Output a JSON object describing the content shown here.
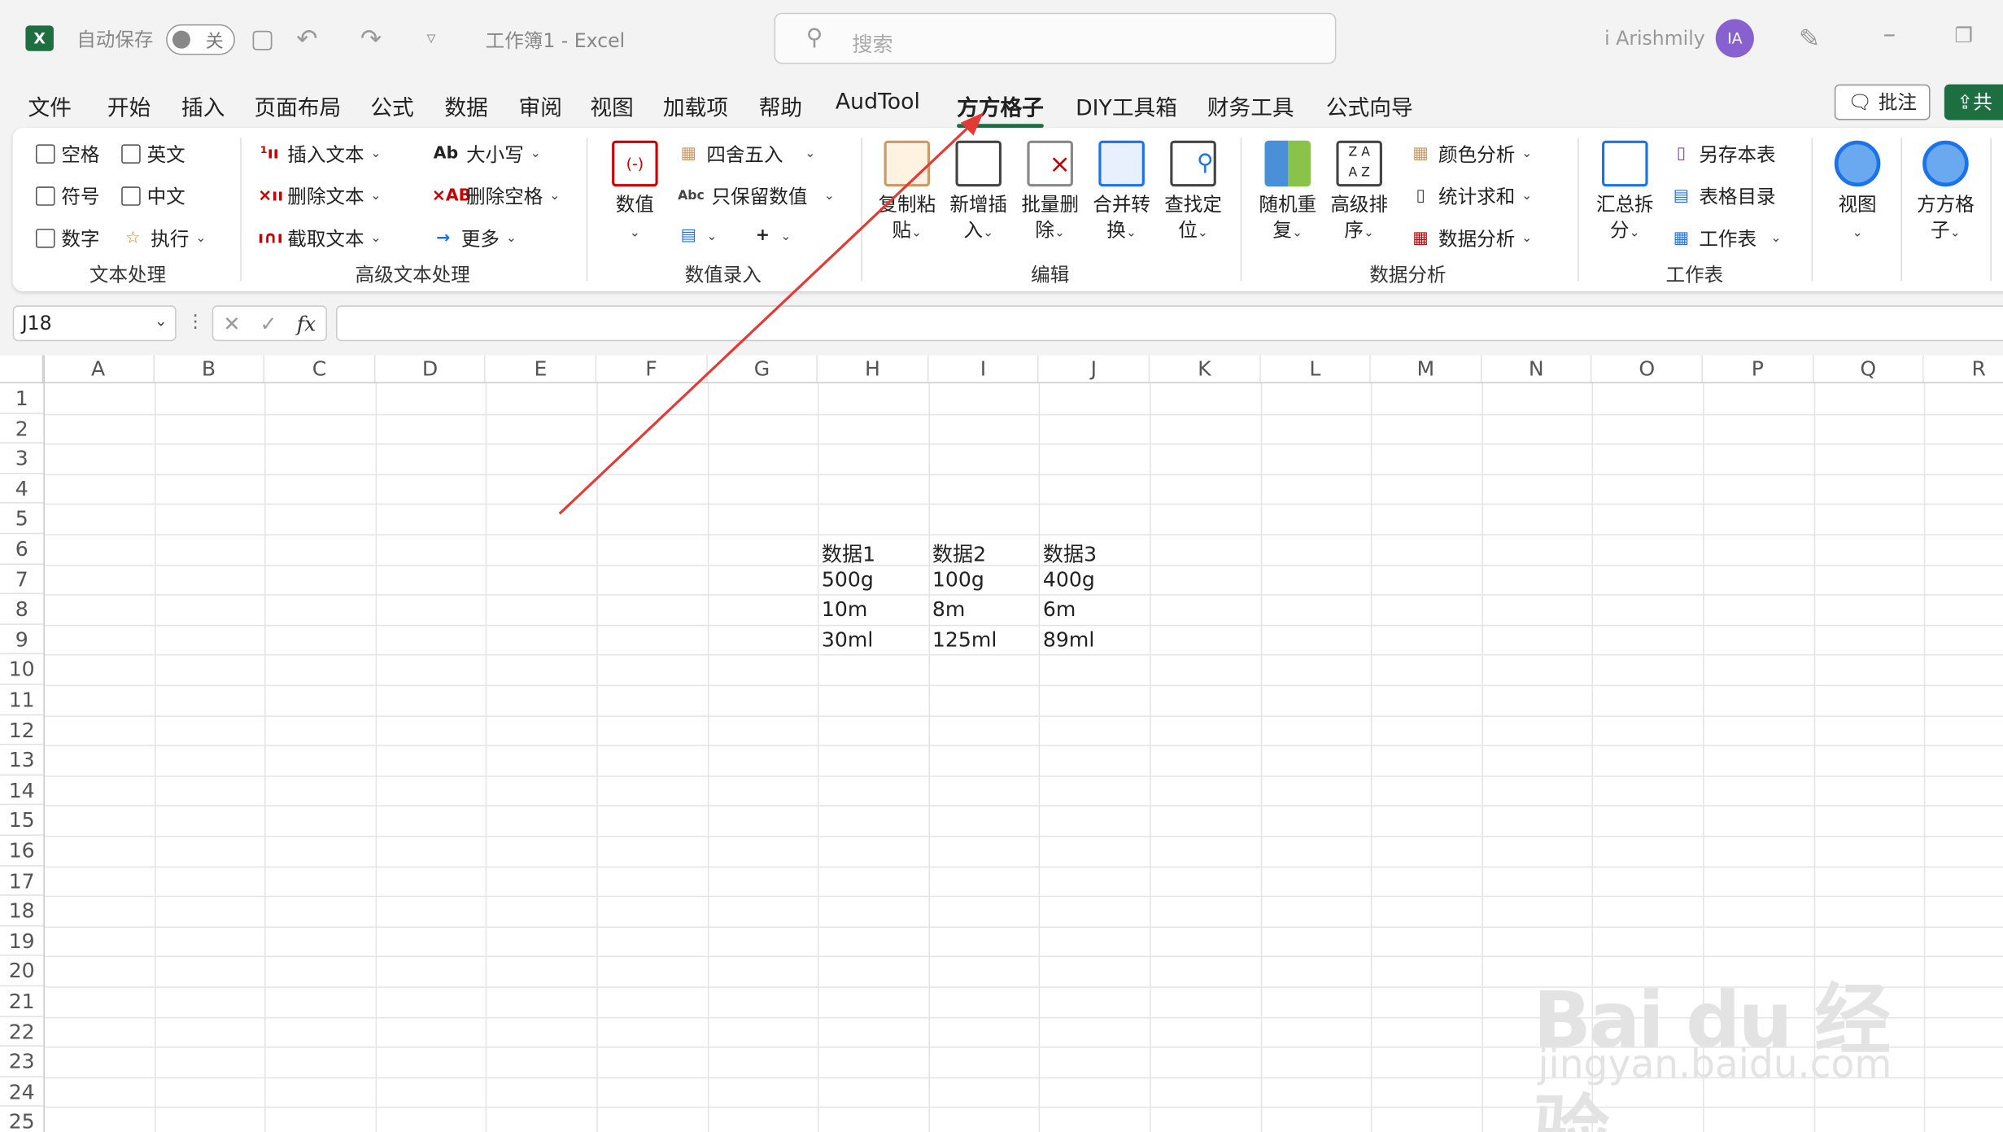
{
  "titlebar": {
    "autosave_label": "自动保存",
    "toggle_label": "关",
    "workbook_title": "工作簿1  -  Excel",
    "search_placeholder": "搜索",
    "user_name": "i Arishmily",
    "avatar_initials": "IA"
  },
  "tabs": [
    "文件",
    "开始",
    "插入",
    "页面布局",
    "公式",
    "数据",
    "审阅",
    "视图",
    "加载项",
    "帮助",
    "AudTool",
    "方方格子",
    "DIY工具箱",
    "财务工具",
    "公式向导"
  ],
  "active_tab": "方方格子",
  "header_buttons": {
    "comment": "批注",
    "share": "共"
  },
  "ribbon": {
    "text_group": {
      "label": "文本处理",
      "items": [
        "空格",
        "英文",
        "符号",
        "中文",
        "数字",
        "执行"
      ]
    },
    "adv_text_group": {
      "label": "高级文本处理",
      "items": [
        "插入文本",
        "删除文本",
        "截取文本",
        "大小写",
        "删除空格",
        "更多"
      ]
    },
    "num_group": {
      "label": "数值录入",
      "big": "数值",
      "items": [
        "四舍五入",
        "只保留数值"
      ]
    },
    "edit_group": {
      "label": "编辑",
      "big": [
        {
          "l1": "复制粘",
          "l2": "贴"
        },
        {
          "l1": "新增插",
          "l2": "入"
        },
        {
          "l1": "批量删",
          "l2": "除"
        },
        {
          "l1": "合并转",
          "l2": "换"
        },
        {
          "l1": "查找定",
          "l2": "位"
        }
      ]
    },
    "analysis_group": {
      "label": "数据分析",
      "big": [
        {
          "l1": "随机重",
          "l2": "复"
        },
        {
          "l1": "高级排",
          "l2": "序"
        }
      ],
      "items": [
        "颜色分析",
        "统计求和",
        "数据分析"
      ]
    },
    "sheet_group": {
      "label": "工作表",
      "big": {
        "l1": "汇总拆",
        "l2": "分"
      },
      "items": [
        "另存本表",
        "表格目录",
        "工作表"
      ]
    },
    "view": {
      "label": "视图"
    },
    "ffgz": {
      "l1": "方方格",
      "l2": "子"
    }
  },
  "formula_bar": {
    "namebox": "J18",
    "fx": "fx"
  },
  "columns": [
    "A",
    "B",
    "C",
    "D",
    "E",
    "F",
    "G",
    "H",
    "I",
    "J",
    "K",
    "L",
    "M",
    "N",
    "O",
    "P",
    "Q",
    "R"
  ],
  "rows": [
    "1",
    "2",
    "3",
    "4",
    "5",
    "6",
    "7",
    "8",
    "9",
    "10",
    "11",
    "12",
    "13",
    "14",
    "15",
    "16",
    "17",
    "18",
    "19",
    "20",
    "21",
    "22",
    "23",
    "24",
    "25"
  ],
  "cells": {
    "H6": "数据1",
    "I6": "数据2",
    "J6": "数据3",
    "H7": "500g",
    "I7": "100g",
    "J7": "400g",
    "H8": "10m",
    "I8": "8m",
    "J8": "6m",
    "H9": "30ml",
    "I9": "125ml",
    "J9": "89ml"
  },
  "annotation_color": "#e53935",
  "accent_color": "#1d6f42",
  "watermark": {
    "brand": "Bai du 经验",
    "url": "jingyan.baidu.com"
  }
}
